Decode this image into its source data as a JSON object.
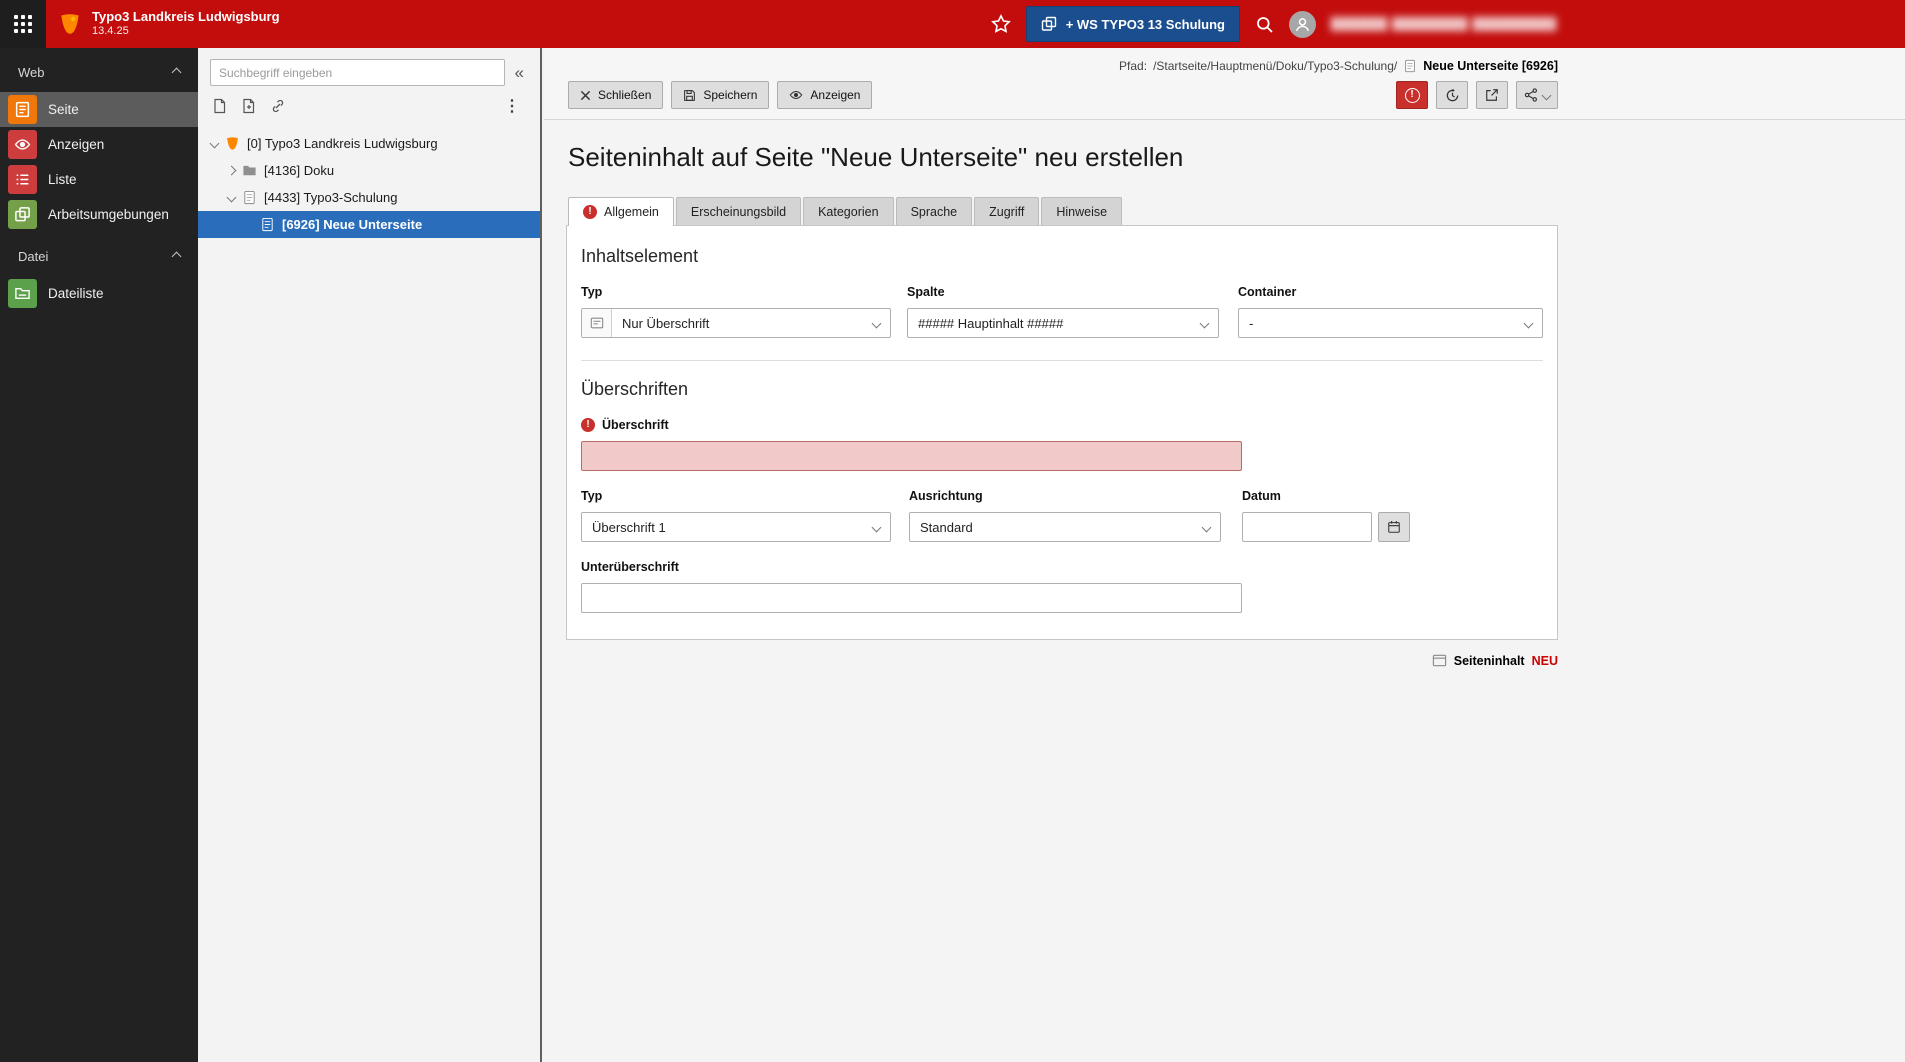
{
  "colors": {
    "topbar_red": "#c30d0d",
    "workspace_button_blue": "#1b4e8e",
    "tree_selected_blue": "#2a6ebb",
    "error_red": "#c9302c",
    "module_page_orange": "#f0780a"
  },
  "topbar": {
    "site_title": "Typo3 Landkreis Ludwigsburg",
    "version": "13.4.25",
    "workspace_button_label": "+ WS TYPO3 13 Schulung",
    "user_display_name": "██████ ████████ █████████"
  },
  "module_menu": {
    "sections": [
      {
        "label": "Web",
        "items": [
          {
            "label": "Seite"
          },
          {
            "label": "Anzeigen"
          },
          {
            "label": "Liste"
          },
          {
            "label": "Arbeitsumgebungen"
          }
        ]
      },
      {
        "label": "Datei",
        "items": [
          {
            "label": "Dateiliste"
          }
        ]
      }
    ]
  },
  "pagetree": {
    "search_placeholder": "Suchbegriff eingeben",
    "nodes": [
      {
        "label": "[0] Typo3 Landkreis Ludwigsburg"
      },
      {
        "label": "[4136] Doku"
      },
      {
        "label": "[4433] Typo3-Schulung"
      },
      {
        "label": "[6926] Neue Unterseite"
      }
    ]
  },
  "docheader": {
    "path_label": "Pfad:",
    "path_value": "/Startseite/Hauptmenü/Doku/Typo3-Schulung/",
    "record_title": "Neue Unterseite [6926]",
    "close_label": "Schließen",
    "save_label": "Speichern",
    "view_label": "Anzeigen"
  },
  "form": {
    "heading": "Seiteninhalt auf Seite \"Neue Unterseite\" neu erstellen",
    "tabs": [
      {
        "label": "Allgemein"
      },
      {
        "label": "Erscheinungsbild"
      },
      {
        "label": "Kategorien"
      },
      {
        "label": "Sprache"
      },
      {
        "label": "Zugriff"
      },
      {
        "label": "Hinweise"
      }
    ],
    "inhaltselement": {
      "title": "Inhaltselement",
      "typ_label": "Typ",
      "typ_value": "Nur Überschrift",
      "spalte_label": "Spalte",
      "spalte_value": "##### Hauptinhalt #####",
      "container_label": "Container",
      "container_value": "-"
    },
    "ueberschriften": {
      "title": "Überschriften",
      "ueberschrift_label": "Überschrift",
      "ueberschrift_value": "",
      "typ_label": "Typ",
      "typ_value": "Überschrift 1",
      "ausrichtung_label": "Ausrichtung",
      "ausrichtung_value": "Standard",
      "datum_label": "Datum",
      "datum_value": "",
      "unterueberschrift_label": "Unterüberschrift",
      "unterueberschrift_value": ""
    },
    "footer_badge_label": "Seiteninhalt",
    "footer_badge_state": "NEU"
  }
}
